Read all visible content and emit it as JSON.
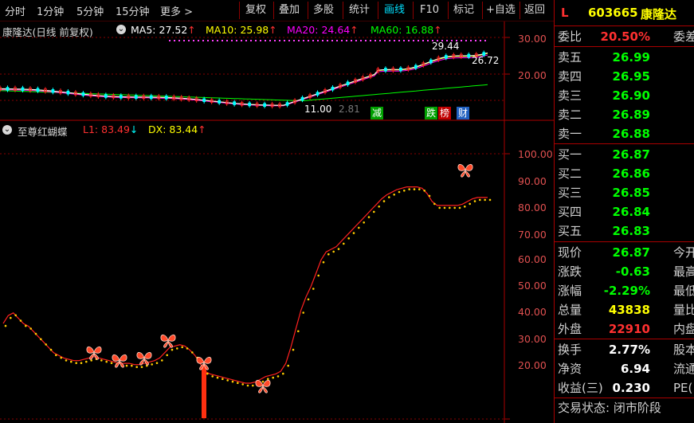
{
  "toolbar": {
    "periods": [
      "分时",
      "1分钟",
      "5分钟",
      "15分钟",
      "更多 >"
    ],
    "buttons": [
      "复权",
      "叠加",
      "多股",
      "统计",
      "画线",
      "F10",
      "标记",
      "+自选",
      "返回"
    ],
    "active_button": "画线"
  },
  "main_chart": {
    "title": "康隆达(日线 前复权)",
    "ma": [
      {
        "label": "MA5:",
        "value": "27.52",
        "color": "#ffffff"
      },
      {
        "label": "MA10:",
        "value": "25.98",
        "color": "#ffff00"
      },
      {
        "label": "MA20:",
        "value": "24.64",
        "color": "#ff00ff"
      },
      {
        "label": "MA60:",
        "value": "16.88",
        "color": "#00ff00"
      }
    ],
    "price_labels": {
      "high": "29.44",
      "last": "26.72",
      "low_a": "11.00",
      "low_b": "2.81"
    },
    "marks": [
      {
        "text": "减",
        "bg": "#00a000"
      },
      {
        "text": "跌",
        "bg": "#00a000"
      },
      {
        "text": "榜",
        "bg": "#c00000"
      },
      {
        "text": "财",
        "bg": "#2060c0"
      }
    ],
    "chart_data": {
      "type": "line",
      "y_ticks": [
        "30.00",
        "20.00"
      ],
      "ylim": [
        8,
        33
      ]
    }
  },
  "indicator": {
    "title": "至尊红蝴蝶",
    "l1_label": "L1:",
    "l1_value": "83.49",
    "l1_arrow": "↓",
    "dx_label": "DX:",
    "dx_value": "83.44",
    "dx_arrow": "↑",
    "chart_data": {
      "type": "line",
      "y_ticks": [
        "100.00",
        "90.00",
        "80.00",
        "70.00",
        "60.00",
        "50.00",
        "40.00",
        "30.00",
        "20.00"
      ],
      "ylim": [
        10,
        110
      ],
      "series": [
        {
          "values": [
            36,
            39,
            40,
            38,
            36,
            35,
            33,
            31,
            29,
            27,
            25,
            24,
            23,
            22.5,
            22,
            22,
            22.5,
            23,
            23.5,
            23,
            22.5,
            22,
            21.5,
            21,
            21,
            21,
            20.5,
            20.5,
            21,
            21.5,
            22,
            23,
            25,
            27,
            27.5,
            28,
            27.5,
            26,
            24,
            21,
            18,
            17,
            16.5,
            16,
            15.5,
            15,
            14.5,
            14,
            13.5,
            13.5,
            14,
            15,
            16,
            16.5,
            17,
            18,
            21,
            27,
            34,
            41,
            46,
            50,
            55,
            60,
            63,
            64,
            65,
            67,
            69,
            71,
            73,
            75,
            77,
            79,
            81,
            83,
            84.5,
            85.5,
            86.5,
            87,
            87.5,
            87.5,
            87.5,
            87,
            85,
            82,
            80.5,
            80.5,
            80.5,
            80.5,
            80.5,
            81,
            82,
            83,
            83.5,
            83.5,
            83.5
          ]
        }
      ]
    }
  },
  "quote": {
    "code": "603665",
    "name": "康隆达",
    "flag": "L",
    "weibi_label": "委比",
    "weibi_value": "20.50%",
    "weibi_extra": "委差",
    "asks": [
      {
        "label": "卖五",
        "price": "26.99"
      },
      {
        "label": "卖四",
        "price": "26.95"
      },
      {
        "label": "卖三",
        "price": "26.90"
      },
      {
        "label": "卖二",
        "price": "26.89"
      },
      {
        "label": "卖一",
        "price": "26.88"
      }
    ],
    "bids": [
      {
        "label": "买一",
        "price": "26.87"
      },
      {
        "label": "买二",
        "price": "26.86"
      },
      {
        "label": "买三",
        "price": "26.85"
      },
      {
        "label": "买四",
        "price": "26.84"
      },
      {
        "label": "买五",
        "price": "26.83"
      }
    ],
    "stats": [
      {
        "label": "现价",
        "value": "26.87",
        "color": "#00ff00",
        "extra": "今开"
      },
      {
        "label": "涨跌",
        "value": "-0.63",
        "color": "#00ff00",
        "extra": "最高"
      },
      {
        "label": "涨幅",
        "value": "-2.29%",
        "color": "#00ff00",
        "extra": "最低"
      },
      {
        "label": "总量",
        "value": "43838",
        "color": "#ffff00",
        "extra": "量比"
      },
      {
        "label": "外盘",
        "value": "22910",
        "color": "#ff3030",
        "extra": "内盘"
      }
    ],
    "fundamentals": [
      {
        "label": "换手",
        "value": "2.77%",
        "color": "#ffffff",
        "extra": "股本"
      },
      {
        "label": "净资",
        "value": "6.94",
        "color": "#ffffff",
        "extra": "流通"
      },
      {
        "label": "收益(三)",
        "value": "0.230",
        "color": "#ffffff",
        "extra": "PE("
      }
    ],
    "trade_status": "交易状态: 闭市阶段"
  },
  "colors": {
    "grid": "#8a0000",
    "up": "#ff2020",
    "down": "#00ffff",
    "dots": "#ffcc00",
    "text": "#cccccc"
  }
}
